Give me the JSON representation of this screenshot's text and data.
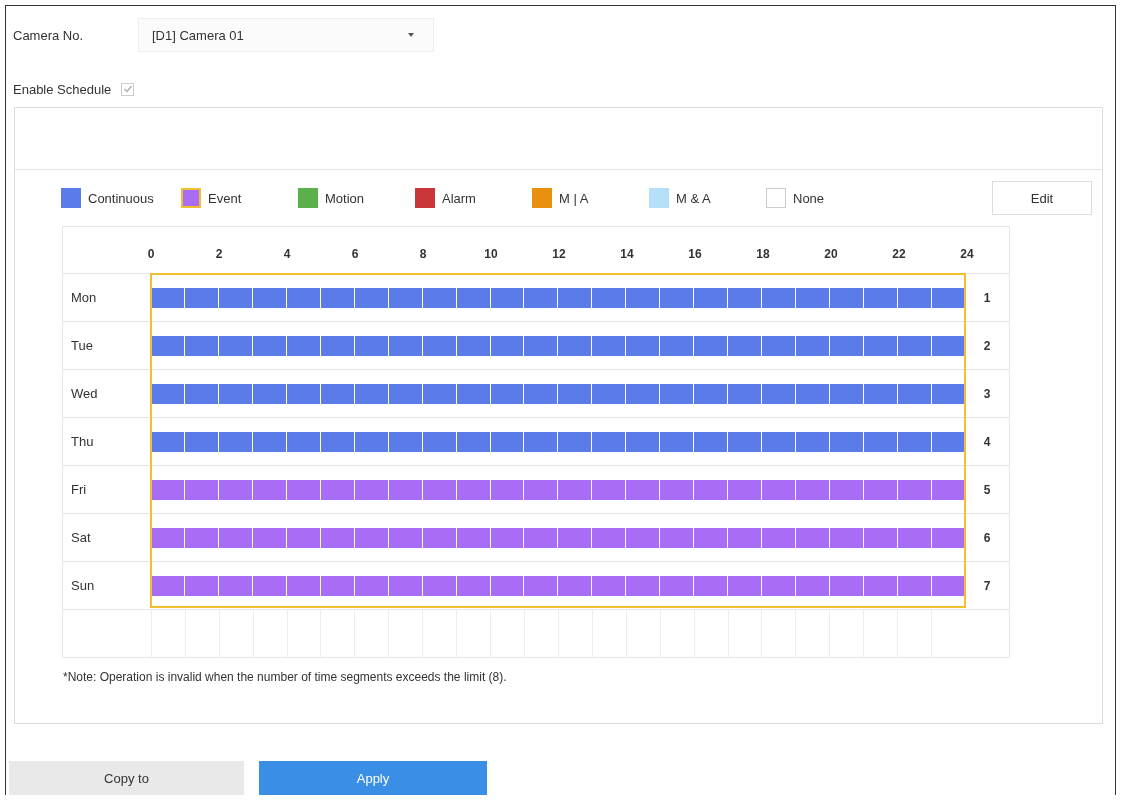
{
  "camera": {
    "label": "Camera No.",
    "value": "[D1] Camera 01"
  },
  "enable_schedule": {
    "label": "Enable Schedule",
    "checked": true
  },
  "legend": [
    {
      "kind": "continuous",
      "label": "Continuous",
      "color": "#5b7be8",
      "selected": false
    },
    {
      "kind": "event",
      "label": "Event",
      "color": "#a86cf5",
      "selected": true
    },
    {
      "kind": "motion",
      "label": "Motion",
      "color": "#5bb04b",
      "selected": false
    },
    {
      "kind": "alarm",
      "label": "Alarm",
      "color": "#c9373a",
      "selected": false
    },
    {
      "kind": "m_or_a",
      "label": "M | A",
      "color": "#e8900f",
      "selected": false
    },
    {
      "kind": "m_and_a",
      "label": "M & A",
      "color": "#b5e0f7",
      "selected": false
    },
    {
      "kind": "none",
      "label": "None",
      "color": "#ffffff",
      "selected": false
    }
  ],
  "edit_button": "Edit",
  "hours": [
    "0",
    "2",
    "4",
    "6",
    "8",
    "10",
    "12",
    "14",
    "16",
    "18",
    "20",
    "22",
    "24"
  ],
  "days": [
    {
      "day": "Mon",
      "kind": "continuous",
      "number": "1"
    },
    {
      "day": "Tue",
      "kind": "continuous",
      "number": "2"
    },
    {
      "day": "Wed",
      "kind": "continuous",
      "number": "3"
    },
    {
      "day": "Thu",
      "kind": "continuous",
      "number": "4"
    },
    {
      "day": "Fri",
      "kind": "event",
      "number": "5"
    },
    {
      "day": "Sat",
      "kind": "event",
      "number": "6"
    },
    {
      "day": "Sun",
      "kind": "event",
      "number": "7"
    }
  ],
  "note": "*Note: Operation is invalid when the number of time segments exceeds the limit (8).",
  "buttons": [
    {
      "kind": "secondary",
      "label": "Copy to"
    },
    {
      "kind": "primary",
      "label": "Apply"
    }
  ]
}
